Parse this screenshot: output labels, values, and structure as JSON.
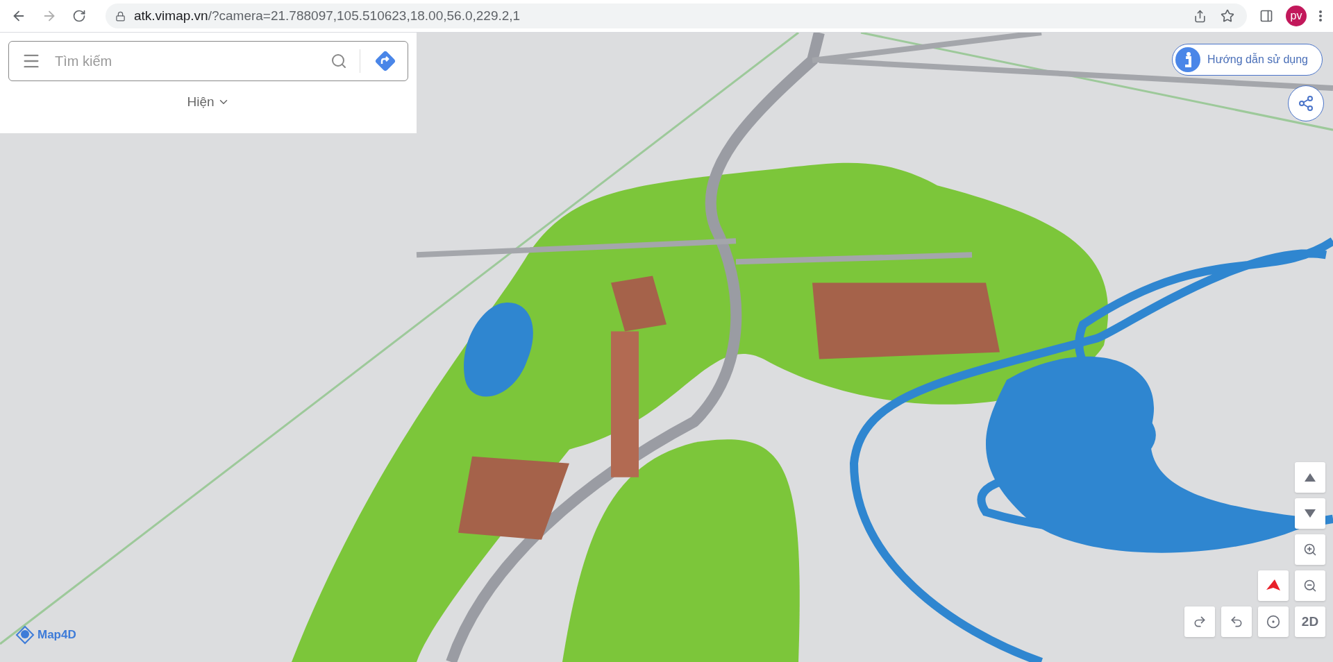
{
  "browser": {
    "url_host": "atk.vimap.vn",
    "url_path": "/?camera=21.788097,105.510623,18.00,56.0,229.2,1",
    "avatar": "pv"
  },
  "search": {
    "placeholder": "Tìm kiếm",
    "toggle_label": "Hiện"
  },
  "guide_button": {
    "label": "Hướng dẫn sử dụng"
  },
  "view_mode_button": {
    "label": "2D"
  },
  "logo": {
    "label": "Map4D"
  }
}
